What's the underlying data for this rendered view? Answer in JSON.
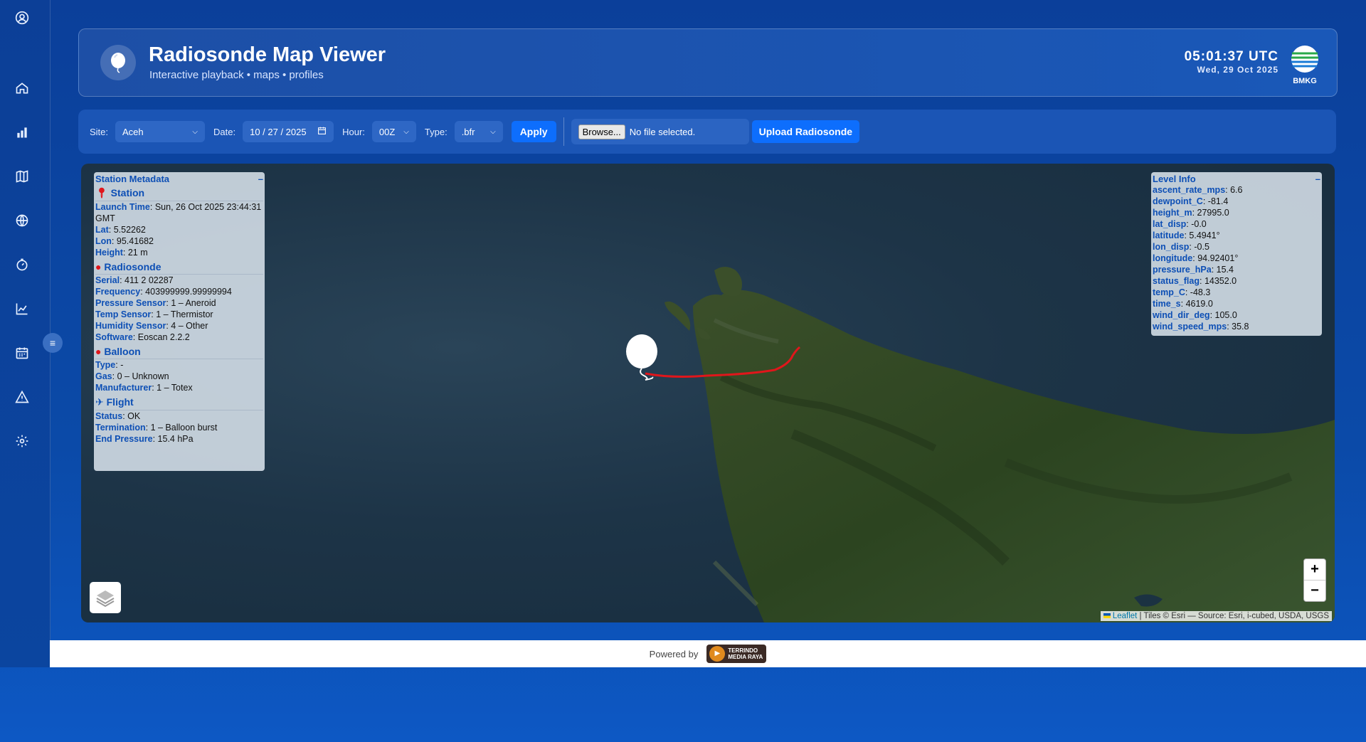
{
  "header": {
    "title": "Radiosonde Map Viewer",
    "subtitle": "Interactive playback • maps • profiles",
    "time": "05:01:37 UTC",
    "date": "Wed, 29 Oct 2025",
    "agency": "BMKG"
  },
  "toolbar": {
    "site_label": "Site:",
    "site_value": "Aceh",
    "date_label": "Date:",
    "date_value": "10 / 27 / 2025",
    "hour_label": "Hour:",
    "hour_value": "00Z",
    "type_label": "Type:",
    "type_value": ".bfr",
    "apply_label": "Apply",
    "browse_label": "Browse...",
    "file_status": "No file selected.",
    "upload_label": "Upload Radiosonde"
  },
  "metadata": {
    "title": "Station Metadata",
    "collapse": "–",
    "station": {
      "title": "Station",
      "rows": [
        {
          "k": "Launch Time",
          "v": "Sun, 26 Oct 2025 23:44:31 GMT"
        },
        {
          "k": "Lat",
          "v": "5.52262"
        },
        {
          "k": "Lon",
          "v": "95.41682"
        },
        {
          "k": "Height",
          "v": "21 m"
        }
      ]
    },
    "radiosonde": {
      "title": "Radiosonde",
      "rows": [
        {
          "k": "Serial",
          "v": "411 2 02287"
        },
        {
          "k": "Frequency",
          "v": "403999999.99999994"
        },
        {
          "k": "Pressure Sensor",
          "v": "1 – Aneroid"
        },
        {
          "k": "Temp Sensor",
          "v": "1 – Thermistor"
        },
        {
          "k": "Humidity Sensor",
          "v": "4 – Other"
        },
        {
          "k": "Software",
          "v": "Eoscan 2.2.2"
        }
      ]
    },
    "balloon": {
      "title": "Balloon",
      "rows": [
        {
          "k": "Type",
          "v": "-"
        },
        {
          "k": "Gas",
          "v": "0 – Unknown"
        },
        {
          "k": "Manufacturer",
          "v": "1 – Totex"
        }
      ]
    },
    "flight": {
      "title": "Flight",
      "rows": [
        {
          "k": "Status",
          "v": "OK"
        },
        {
          "k": "Termination",
          "v": "1 – Balloon burst"
        },
        {
          "k": "End Pressure",
          "v": "15.4 hPa"
        }
      ]
    }
  },
  "level_info": {
    "title": "Level Info",
    "collapse": "–",
    "rows": [
      {
        "k": "ascent_rate_mps",
        "v": "6.6"
      },
      {
        "k": "dewpoint_C",
        "v": "-81.4"
      },
      {
        "k": "height_m",
        "v": "27995.0"
      },
      {
        "k": "lat_disp",
        "v": "-0.0"
      },
      {
        "k": "latitude",
        "v": "5.4941°"
      },
      {
        "k": "lon_disp",
        "v": "-0.5"
      },
      {
        "k": "longitude",
        "v": "94.92401°"
      },
      {
        "k": "pressure_hPa",
        "v": "15.4"
      },
      {
        "k": "status_flag",
        "v": "14352.0"
      },
      {
        "k": "temp_C",
        "v": "-48.3"
      },
      {
        "k": "time_s",
        "v": "4619.0"
      },
      {
        "k": "wind_dir_deg",
        "v": "105.0"
      },
      {
        "k": "wind_speed_mps",
        "v": "35.8"
      }
    ]
  },
  "map": {
    "zoom_in": "+",
    "zoom_out": "−",
    "attribution_link": "Leaflet",
    "attribution_text": " | Tiles © Esri — Source: Esri, i-cubed, USDA, USGS",
    "track_color": "#e0161b"
  },
  "footer": {
    "powered_by": "Powered by",
    "brand_line1": "TERRINDO",
    "brand_line2": "MEDIA RAYA"
  },
  "sidebar_icons": [
    "user-icon",
    "home-icon",
    "bar-chart-icon",
    "map-icon",
    "globe-icon",
    "timer-icon",
    "line-chart-icon",
    "calendar-icon",
    "warning-icon",
    "settings-icon"
  ],
  "sidebar_toggle": "≡"
}
